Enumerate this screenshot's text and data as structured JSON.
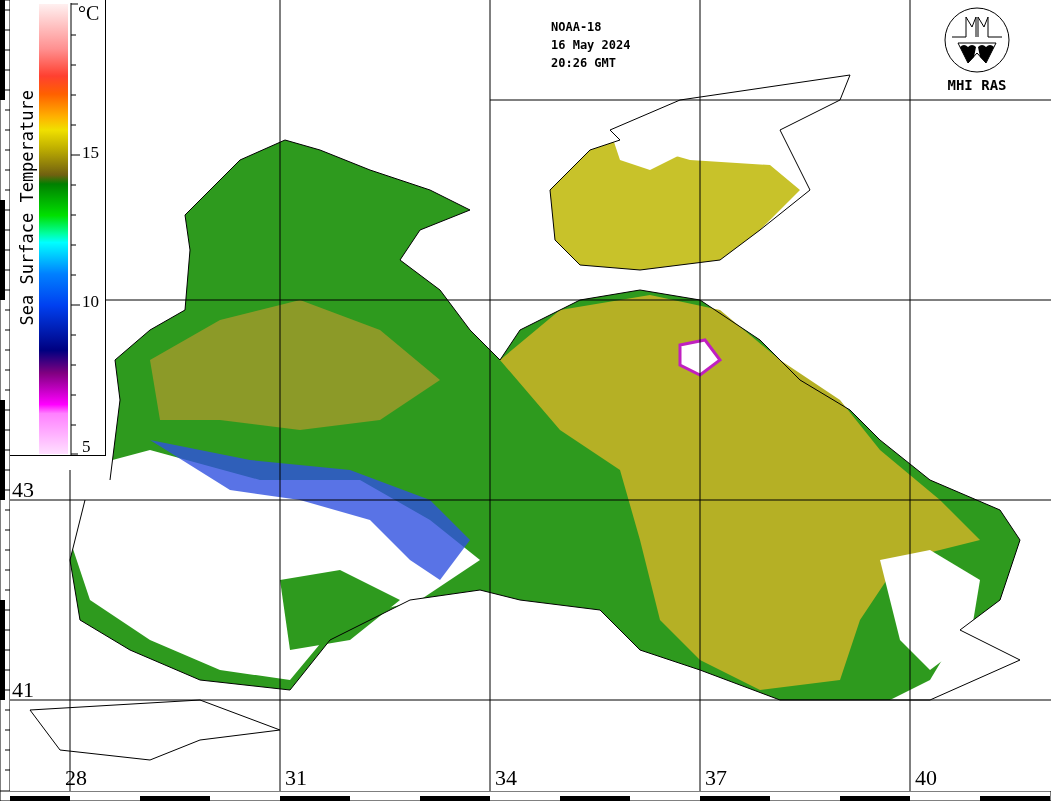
{
  "header": {
    "lines": [
      "NOAA-18",
      "16 May 2024",
      "20:26 GMT"
    ]
  },
  "logo": {
    "label": "MHI RAS"
  },
  "legend": {
    "title": "Sea Surface Temperature",
    "unit": "°C",
    "ticks": [
      "15",
      "10",
      "5"
    ]
  },
  "latitudes": [
    "43",
    "41"
  ],
  "longitudes": [
    "28",
    "31",
    "34",
    "37",
    "40"
  ]
}
